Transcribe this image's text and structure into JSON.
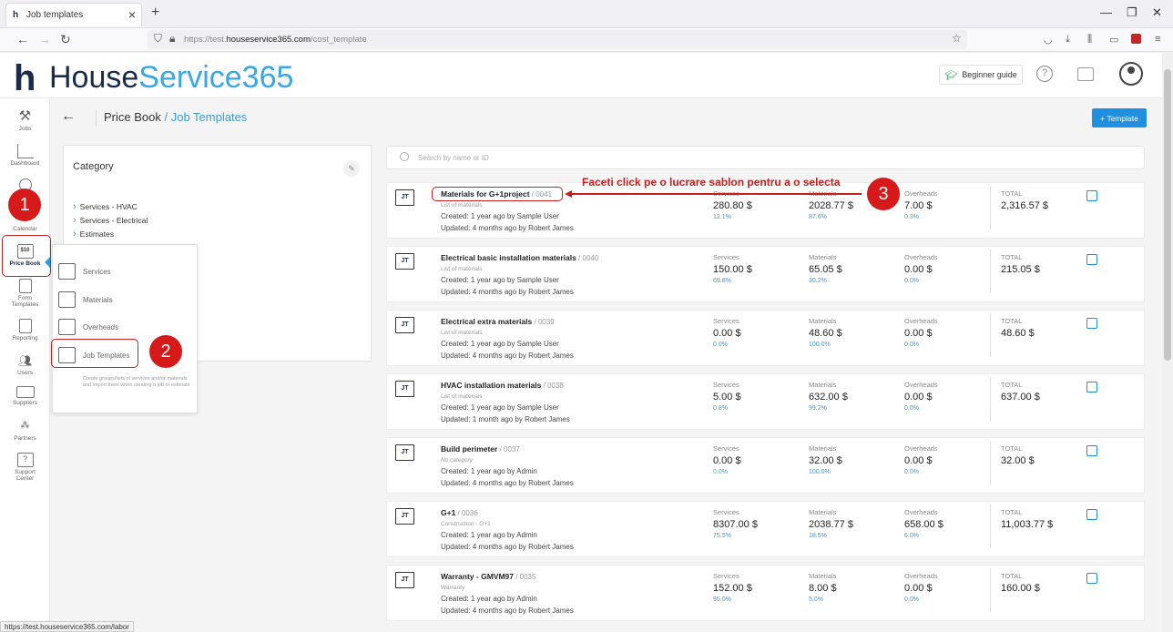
{
  "browser": {
    "tab_title": "Job templates",
    "tab_close": "×",
    "new_tab": "+",
    "url_prefix": "https://test.",
    "url_domain": "houseservice365.com",
    "url_path": "/cost_template",
    "status_url": "https://test.houseservice365.com/labor"
  },
  "header": {
    "logo_house": "House",
    "logo_service": "Service365",
    "beginner_guide": "Beginner guide",
    "help_symbol": "?"
  },
  "sidebar": {
    "items": [
      {
        "label": "Jobs",
        "icon": "tools-icon"
      },
      {
        "label": "Dashboard",
        "icon": "chart-icon"
      },
      {
        "label": "Calendar",
        "icon": "calendar-icon"
      },
      {
        "label": "Price Book",
        "icon": "price-tag-icon",
        "badge": "$10"
      },
      {
        "label": "Form Templates",
        "icon": "form-icon"
      },
      {
        "label": "Reporting",
        "icon": "report-icon"
      },
      {
        "label": "Users",
        "icon": "users-icon"
      },
      {
        "label": "Suppliers",
        "icon": "truck-icon"
      },
      {
        "label": "Partners",
        "icon": "partners-icon"
      },
      {
        "label": "Support Center",
        "icon": "help-icon"
      }
    ]
  },
  "page": {
    "crumb_main": "Price Book",
    "crumb_sub": " / Job Templates",
    "add_button": "+ Template",
    "search_placeholder": "Search by name or ID"
  },
  "category": {
    "title": "Category",
    "items": [
      "Services - HVAC",
      "Services - Electrical",
      "Estimates"
    ]
  },
  "price_book_menu": {
    "items": [
      "Services",
      "Materials",
      "Overheads",
      "Job Templates"
    ],
    "description": "Create groups/lists of services and/or materials and import them when creating a job or estimate"
  },
  "annotations": {
    "step1": "1",
    "step2": "2",
    "step3": "3",
    "instruction": "Faceti click pe o lucrare sablon pentru a o selecta",
    "color": "#c81e1e"
  },
  "columns": {
    "services": "Services",
    "materials": "Materials",
    "overheads": "Overheads",
    "total": "TOTAL"
  },
  "templates": [
    {
      "badge": "JT",
      "name": "Materials for G+1project",
      "id": " / 0041",
      "category": "List of materials",
      "created": "Created: 1 year ago by Sample User",
      "updated": "Updated: 4 months ago by Robert James",
      "services": "280.80 $",
      "services_pct": "12.1%",
      "materials": "2028.77 $",
      "materials_pct": "87.6%",
      "overheads": "7.00 $",
      "overheads_pct": "0.3%",
      "total": "2,316.57 $"
    },
    {
      "badge": "JT",
      "name": "Electrical basic installation materials",
      "id": " / 0040",
      "category": "List of materials",
      "created": "Created: 1 year ago by Sample User",
      "updated": "Updated: 4 months ago by Robert James",
      "services": "150.00 $",
      "services_pct": "69.8%",
      "materials": "65.05 $",
      "materials_pct": "30.2%",
      "overheads": "0.00 $",
      "overheads_pct": "0.0%",
      "total": "215.05 $"
    },
    {
      "badge": "JT",
      "name": "Electrical extra materials",
      "id": " / 0039",
      "category": "List of materials",
      "created": "Created: 1 year ago by Sample User",
      "updated": "Updated: 4 months ago by Robert James",
      "services": "0.00 $",
      "services_pct": "0.0%",
      "materials": "48.60 $",
      "materials_pct": "100.0%",
      "overheads": "0.00 $",
      "overheads_pct": "0.0%",
      "total": "48.60 $"
    },
    {
      "badge": "JT",
      "name": "HVAC installation materials",
      "id": " / 0038",
      "category": "List of materials",
      "created": "Created: 1 year ago by Sample User",
      "updated": "Updated: 1 month ago by Robert James",
      "services": "5.00 $",
      "services_pct": "0.8%",
      "materials": "632.00 $",
      "materials_pct": "99.2%",
      "overheads": "0.00 $",
      "overheads_pct": "0.0%",
      "total": "637.00 $"
    },
    {
      "badge": "JT",
      "name": "Build perimeter",
      "id": " / 0037",
      "category": "No category",
      "created": "Created: 1 year ago by Admin",
      "updated": "Updated: 4 months ago by Robert James",
      "services": "0.00 $",
      "services_pct": "0.0%",
      "materials": "32.00 $",
      "materials_pct": "100.0%",
      "overheads": "0.00 $",
      "overheads_pct": "0.0%",
      "total": "32.00 $"
    },
    {
      "badge": "JT",
      "name": "G+1",
      "id": " / 0036",
      "category": "Construction - G+1",
      "created": "Created: 1 year ago by Admin",
      "updated": "Updated: 4 months ago by Robert James",
      "services": "8307.00 $",
      "services_pct": "75.5%",
      "materials": "2038.77 $",
      "materials_pct": "18.5%",
      "overheads": "658.00 $",
      "overheads_pct": "6.0%",
      "total": "11,003.77 $"
    },
    {
      "badge": "JT",
      "name": "Warranty - GMVM97",
      "id": " / 0035",
      "category": "Warranty",
      "created": "Created: 1 year ago by Admin",
      "updated": "Updated: 4 months ago by Robert James",
      "services": "152.00 $",
      "services_pct": "95.0%",
      "materials": "8.00 $",
      "materials_pct": "5.0%",
      "overheads": "0.00 $",
      "overheads_pct": "0.0%",
      "total": "160.00 $"
    }
  ]
}
